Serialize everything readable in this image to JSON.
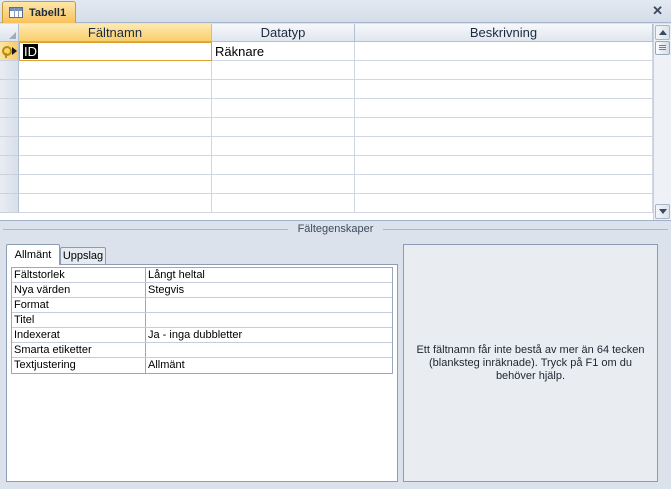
{
  "document_tab": {
    "title": "Tabell1",
    "icon": "table-icon"
  },
  "close_icon": "close-icon",
  "columns": [
    {
      "label": "Fältnamn"
    },
    {
      "label": "Datatyp"
    },
    {
      "label": "Beskrivning"
    }
  ],
  "rows": [
    {
      "name": "ID",
      "type": "Räknare",
      "description": "",
      "primary_key": true
    }
  ],
  "properties": {
    "section_title": "Fältegenskaper",
    "tabs": [
      {
        "label": "Allmänt",
        "active": true
      },
      {
        "label": "Uppslag",
        "active": false
      }
    ],
    "items": [
      {
        "name": "Fältstorlek",
        "value": "Långt heltal"
      },
      {
        "name": "Nya värden",
        "value": "Stegvis"
      },
      {
        "name": "Format",
        "value": ""
      },
      {
        "name": "Titel",
        "value": ""
      },
      {
        "name": "Indexerat",
        "value": "Ja - inga dubbletter"
      },
      {
        "name": "Smarta etiketter",
        "value": ""
      },
      {
        "name": "Textjustering",
        "value": "Allmänt"
      }
    ],
    "help_text": "Ett fältnamn får inte bestå av mer än 64 tecken (blanksteg inräknade). Tryck på F1 om du behöver hjälp."
  },
  "colors": {
    "active_accent": "#f9cf6d",
    "header_bg": "#e1e7ef",
    "panel_bg": "#dbe2ec"
  }
}
